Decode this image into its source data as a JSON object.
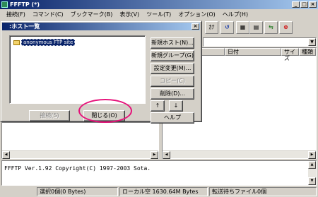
{
  "app": {
    "title": "FFFTP (*)"
  },
  "titlebar_buttons": [
    "_",
    "□",
    "×"
  ],
  "menu": [
    "接続(F)",
    "コマンド(C)",
    "ブックマーク(B)",
    "表示(V)",
    "ツール(T)",
    "オプション(O)",
    "ヘルプ(H)"
  ],
  "toolbar": {
    "text_mode_label": "ｶﾅ",
    "refresh_label": "↺",
    "list_label": "▦",
    "details_label": "▤",
    "sync_label": "⇆",
    "stop_label": "⊗"
  },
  "remote": {
    "columns": {
      "date": "日付",
      "size": "サイズ",
      "kind": "種類"
    }
  },
  "log": {
    "text": "FFFTP Ver.1.92 Copyright(C) 1997-2003 Sota."
  },
  "status": {
    "selection": "選択0個(0 Bytes)",
    "local_free": "ローカル空 1630.64M Bytes",
    "queue": "転送待ちファイル0個"
  },
  "dialog": {
    "title": ":ホスト一覧",
    "close_label": "×",
    "hosts": [
      "anonymous FTP site"
    ],
    "buttons": {
      "new_host": "新規ホスト(N)...",
      "new_group": "新規グループ(G)...",
      "modify": "設定変更(M)...",
      "copy": "コピー(C)",
      "delete": "削除(D)...",
      "up": "↑",
      "down": "↓",
      "help": "ヘルプ",
      "connect": "接続(S)",
      "close": "閉じる(O)"
    }
  }
}
